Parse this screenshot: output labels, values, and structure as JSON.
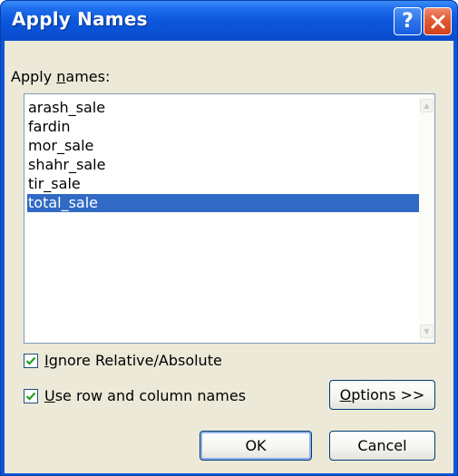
{
  "window": {
    "title": "Apply Names"
  },
  "titlebar": {
    "help_glyph": "?",
    "close_glyph": "✕"
  },
  "label": {
    "apply_names_pre": "Apply ",
    "apply_names_ul": "n",
    "apply_names_post": "ames:"
  },
  "list": {
    "items": [
      "arash_sale",
      "fardin",
      "mor_sale",
      "shahr_sale",
      "tir_sale",
      "total_sale"
    ],
    "selected": "total_sale"
  },
  "options": {
    "ignore_relative": {
      "ul": "I",
      "rest": "gnore Relative/Absolute",
      "checked": true
    },
    "use_row_column": {
      "ul": "U",
      "rest": "se row and column names",
      "checked": true
    }
  },
  "buttons": {
    "options_ul": "O",
    "options_rest": "ptions >>",
    "ok": "OK",
    "cancel": "Cancel"
  },
  "colors": {
    "titlebar": "#0b57d8",
    "selection": "#316ac5",
    "dialog": "#ece9d8"
  }
}
